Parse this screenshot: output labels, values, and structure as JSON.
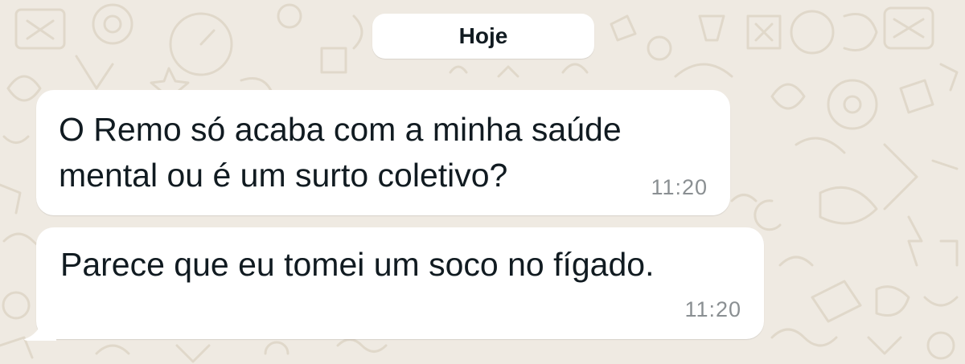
{
  "chat": {
    "date_label": "Hoje",
    "messages": [
      {
        "lines": [
          "O Remo só acaba com a minha saúde",
          "mental ou é um surto coletivo?"
        ],
        "time": "11:20"
      },
      {
        "lines": [
          "Parece que eu tomei um soco no fígado."
        ],
        "time": "11:20"
      }
    ]
  },
  "colors": {
    "wallpaper": "#efeae2",
    "wallpaper_doodle": "#e3dccf",
    "bubble": "#ffffff",
    "text": "#111b21",
    "timestamp": "#8a8f92"
  },
  "icons": [
    "wallpaper-doodle-pattern",
    "bubble-tail"
  ]
}
